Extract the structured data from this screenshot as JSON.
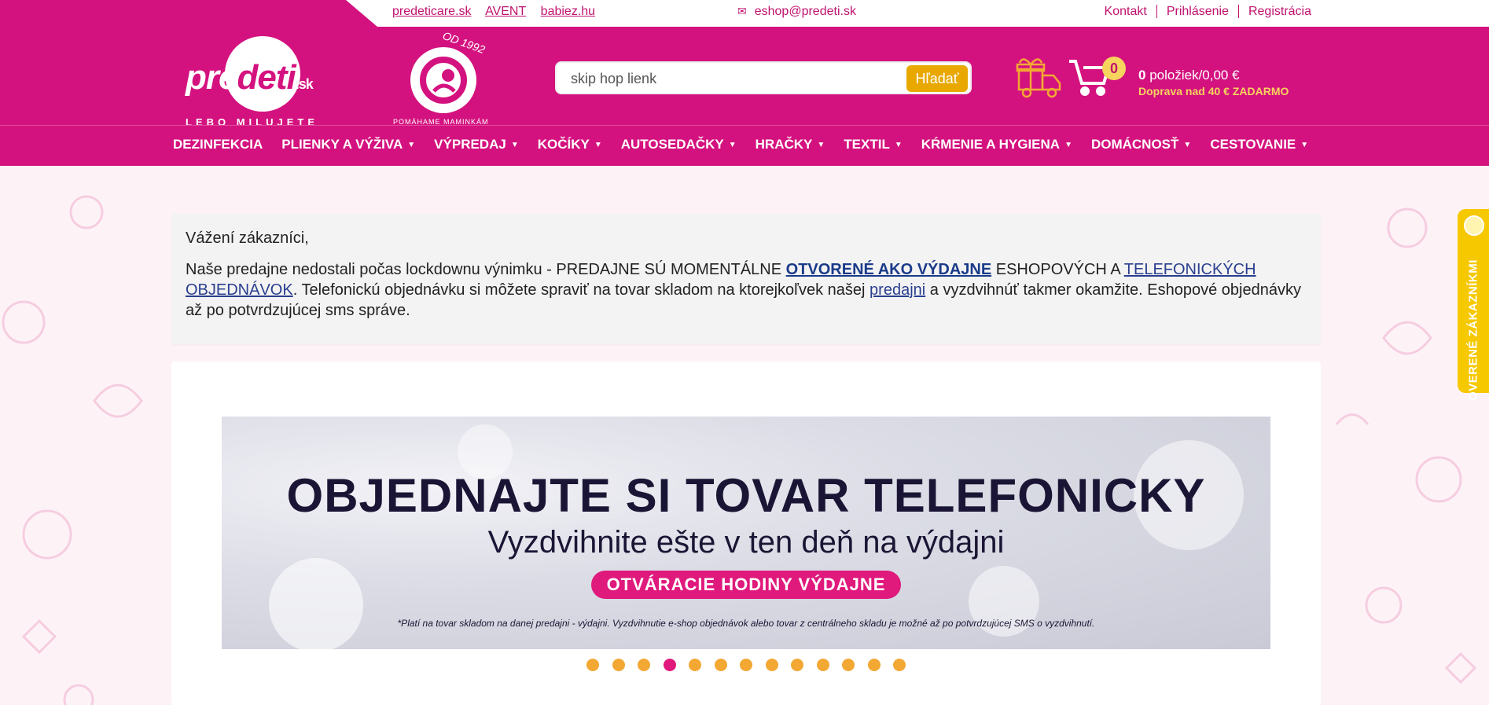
{
  "top_links": [
    "predeticare.sk",
    "AVENT",
    "babiez.hu"
  ],
  "top_email": "eshop@predeti.sk",
  "top_right_links": [
    "Kontakt",
    "Prihlásenie",
    "Registrácia"
  ],
  "logo": {
    "pre": "pre",
    "deti": "deti",
    "sk": ".sk",
    "tagline": "LEBO MILUJETE"
  },
  "badge": {
    "od": "OD 1992",
    "text": "POMÁHAME MAMINKÁM"
  },
  "search": {
    "value": "skip hop lienk",
    "button_label": "Hľadať"
  },
  "cart": {
    "count": "0",
    "summary_bold": "0",
    "summary_rest": " položiek/0,00 €",
    "shipping": "Doprava nad 40 € ZADARMO"
  },
  "nav": [
    {
      "label": "DEZINFEKCIA",
      "caret": false
    },
    {
      "label": "PLIENKY A VÝŽIVA",
      "caret": true
    },
    {
      "label": "VÝPREDAJ",
      "caret": true
    },
    {
      "label": "KOČÍKY",
      "caret": true
    },
    {
      "label": "AUTOSEDAČKY",
      "caret": true
    },
    {
      "label": "HRAČKY",
      "caret": true
    },
    {
      "label": "TEXTIL",
      "caret": true
    },
    {
      "label": "KŔMENIE A HYGIENA",
      "caret": true
    },
    {
      "label": "DOMÁCNOSŤ",
      "caret": true
    },
    {
      "label": "CESTOVANIE",
      "caret": true
    }
  ],
  "notice": {
    "greeting": "Vážení zákazníci,",
    "t1": "Naše predajne nedostali počas lockdownu výnimku - PREDAJNE SÚ MOMENTÁLNE ",
    "link1": "OTVORENÉ AKO VÝDAJNE",
    "t2": " ESHOPOVÝCH A ",
    "link2": "TELEFONICKÝCH OBJEDNÁVOK",
    "t3": ". Telefonickú objednávku si môžete spraviť na tovar skladom na ktorejkoľvek našej ",
    "link3": "predajni",
    "t4": " a vyzdvihnúť takmer okamžite. Eshopové objednávky až po potvrdzujúcej sms správe."
  },
  "banner": {
    "headline": "OBJEDNAJTE SI TOVAR TELEFONICKY",
    "subline": "Vyzdvihnite ešte v ten deň na výdajni",
    "pill": "OTVÁRACIE HODINY VÝDAJNE",
    "fine": "*Platí na tovar skladom na danej predajni - výdajni. Vyzdvihnutie e-shop objednávok alebo tovar z centrálneho skladu je možné až po potvrdzujúcej SMS o vyzdvihnutí."
  },
  "slider": {
    "dot_count": 13,
    "active_index": 3
  },
  "side_tab": {
    "label": "OVERENÉ ZÁKAZNÍKMI"
  },
  "colors": {
    "brand": "#d4127f",
    "accent_yellow": "#e8a800",
    "dot": "#f2a833",
    "link": "#2a3f8f"
  },
  "icons": [
    "mail-icon",
    "gift-delivery-icon",
    "cart-icon",
    "caret-down-icon",
    "medal-icon"
  ]
}
